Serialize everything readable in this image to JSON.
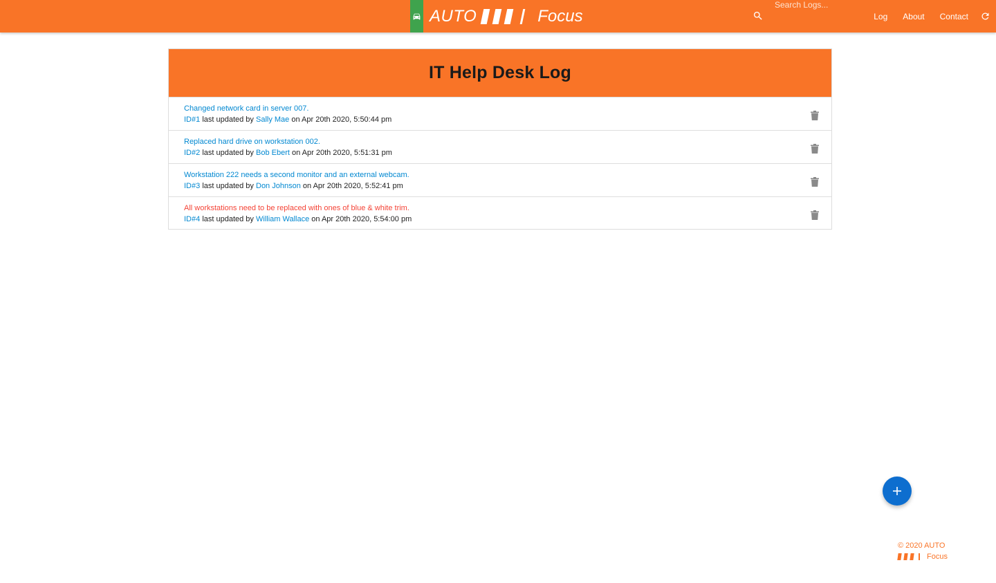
{
  "navbar": {
    "brand": {
      "auto_text": "AUTO",
      "focus_text": "Focus",
      "icon": "car-icon"
    },
    "search": {
      "placeholder": "Search Logs...",
      "value": "",
      "icon": "search-icon"
    },
    "links": [
      {
        "label": "Log"
      },
      {
        "label": "About"
      },
      {
        "label": "Contact"
      }
    ],
    "refresh_icon": "refresh-icon"
  },
  "panel": {
    "title": "IT Help Desk Log",
    "logs": [
      {
        "message": "Changed network card in server 007.",
        "attention": false,
        "id_label": "ID#1",
        "prefix": "last updated by",
        "tech": "Sally Mae",
        "date_text": "on Apr 20th 2020, 5:50:44 pm"
      },
      {
        "message": "Replaced hard drive on workstation 002.",
        "attention": false,
        "id_label": "ID#2",
        "prefix": "last updated by",
        "tech": "Bob Ebert",
        "date_text": "on Apr 20th 2020, 5:51:31 pm"
      },
      {
        "message": "Workstation 222 needs a second monitor and an external webcam.",
        "attention": false,
        "id_label": "ID#3",
        "prefix": "last updated by",
        "tech": "Don Johnson",
        "date_text": "on Apr 20th 2020, 5:52:41 pm"
      },
      {
        "message": "All workstations need to be replaced with ones of blue & white trim.",
        "attention": true,
        "id_label": "ID#4",
        "prefix": "last updated by",
        "tech": "William Wallace",
        "date_text": "on Apr 20th 2020, 5:54:00 pm"
      }
    ]
  },
  "fab": {
    "icon": "plus-icon"
  },
  "footer": {
    "copyright": "© 2020 AUTO",
    "focus_text": "Focus"
  },
  "colors": {
    "brand_orange": "#f97427",
    "badge_green": "#3fa34d",
    "link_blue": "#0288d1",
    "attention_red": "#f44336",
    "fab_blue": "#0d6ecf"
  }
}
